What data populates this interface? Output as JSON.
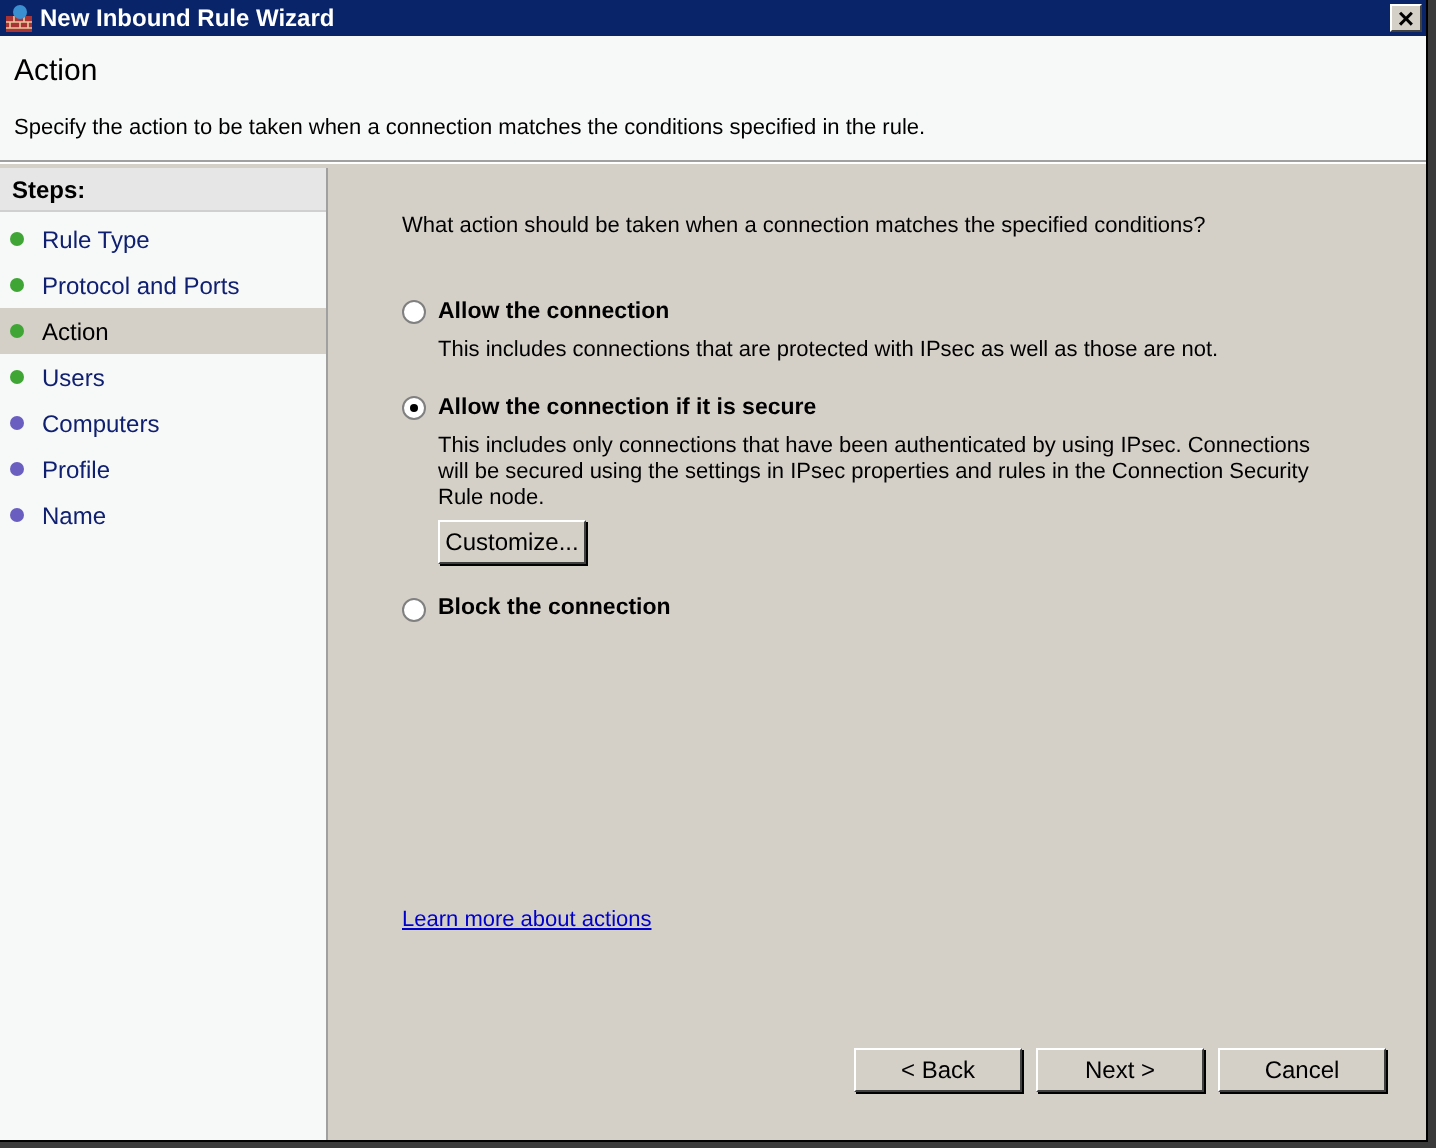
{
  "window": {
    "title": "New Inbound Rule Wizard",
    "close": "×"
  },
  "header": {
    "title": "Action",
    "description": "Specify the action to be taken when a connection matches the conditions specified in the rule."
  },
  "steps": {
    "title": "Steps:",
    "items": [
      {
        "label": "Rule Type",
        "color": "#3fa535",
        "selected": false
      },
      {
        "label": "Protocol and Ports",
        "color": "#3fa535",
        "selected": false
      },
      {
        "label": "Action",
        "color": "#3fa535",
        "selected": true
      },
      {
        "label": "Users",
        "color": "#3fa535",
        "selected": false
      },
      {
        "label": "Computers",
        "color": "#6a5fc1",
        "selected": false
      },
      {
        "label": "Profile",
        "color": "#6a5fc1",
        "selected": false
      },
      {
        "label": "Name",
        "color": "#6a5fc1",
        "selected": false
      }
    ]
  },
  "question": "What action should be taken when a connection matches the specified conditions?",
  "options": [
    {
      "label": "Allow the connection",
      "description": "This includes connections that are protected with IPsec as well as those are not.",
      "selected": false
    },
    {
      "label": "Allow the connection if it is secure",
      "description": "This includes only connections that have been authenticated by using IPsec.  Connections will be secured using the settings in IPsec properties and rules in the Connection Security Rule node.",
      "selected": true,
      "button": "Customize..."
    },
    {
      "label": "Block the connection",
      "selected": false
    }
  ],
  "link": "Learn more about actions",
  "buttons": [
    "< Back",
    "Next >",
    "Cancel"
  ]
}
